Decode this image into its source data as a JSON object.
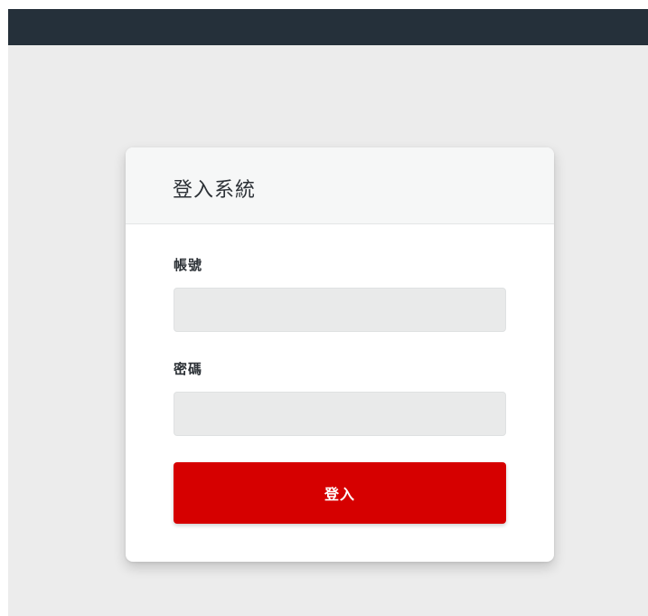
{
  "login_form": {
    "title": "登入系統",
    "username_label": "帳號",
    "username_value": "",
    "password_label": "密碼",
    "password_value": "",
    "submit_label": "登入"
  },
  "colors": {
    "topbar": "#25303a",
    "background": "#ececec",
    "submit_button": "#d60000"
  }
}
